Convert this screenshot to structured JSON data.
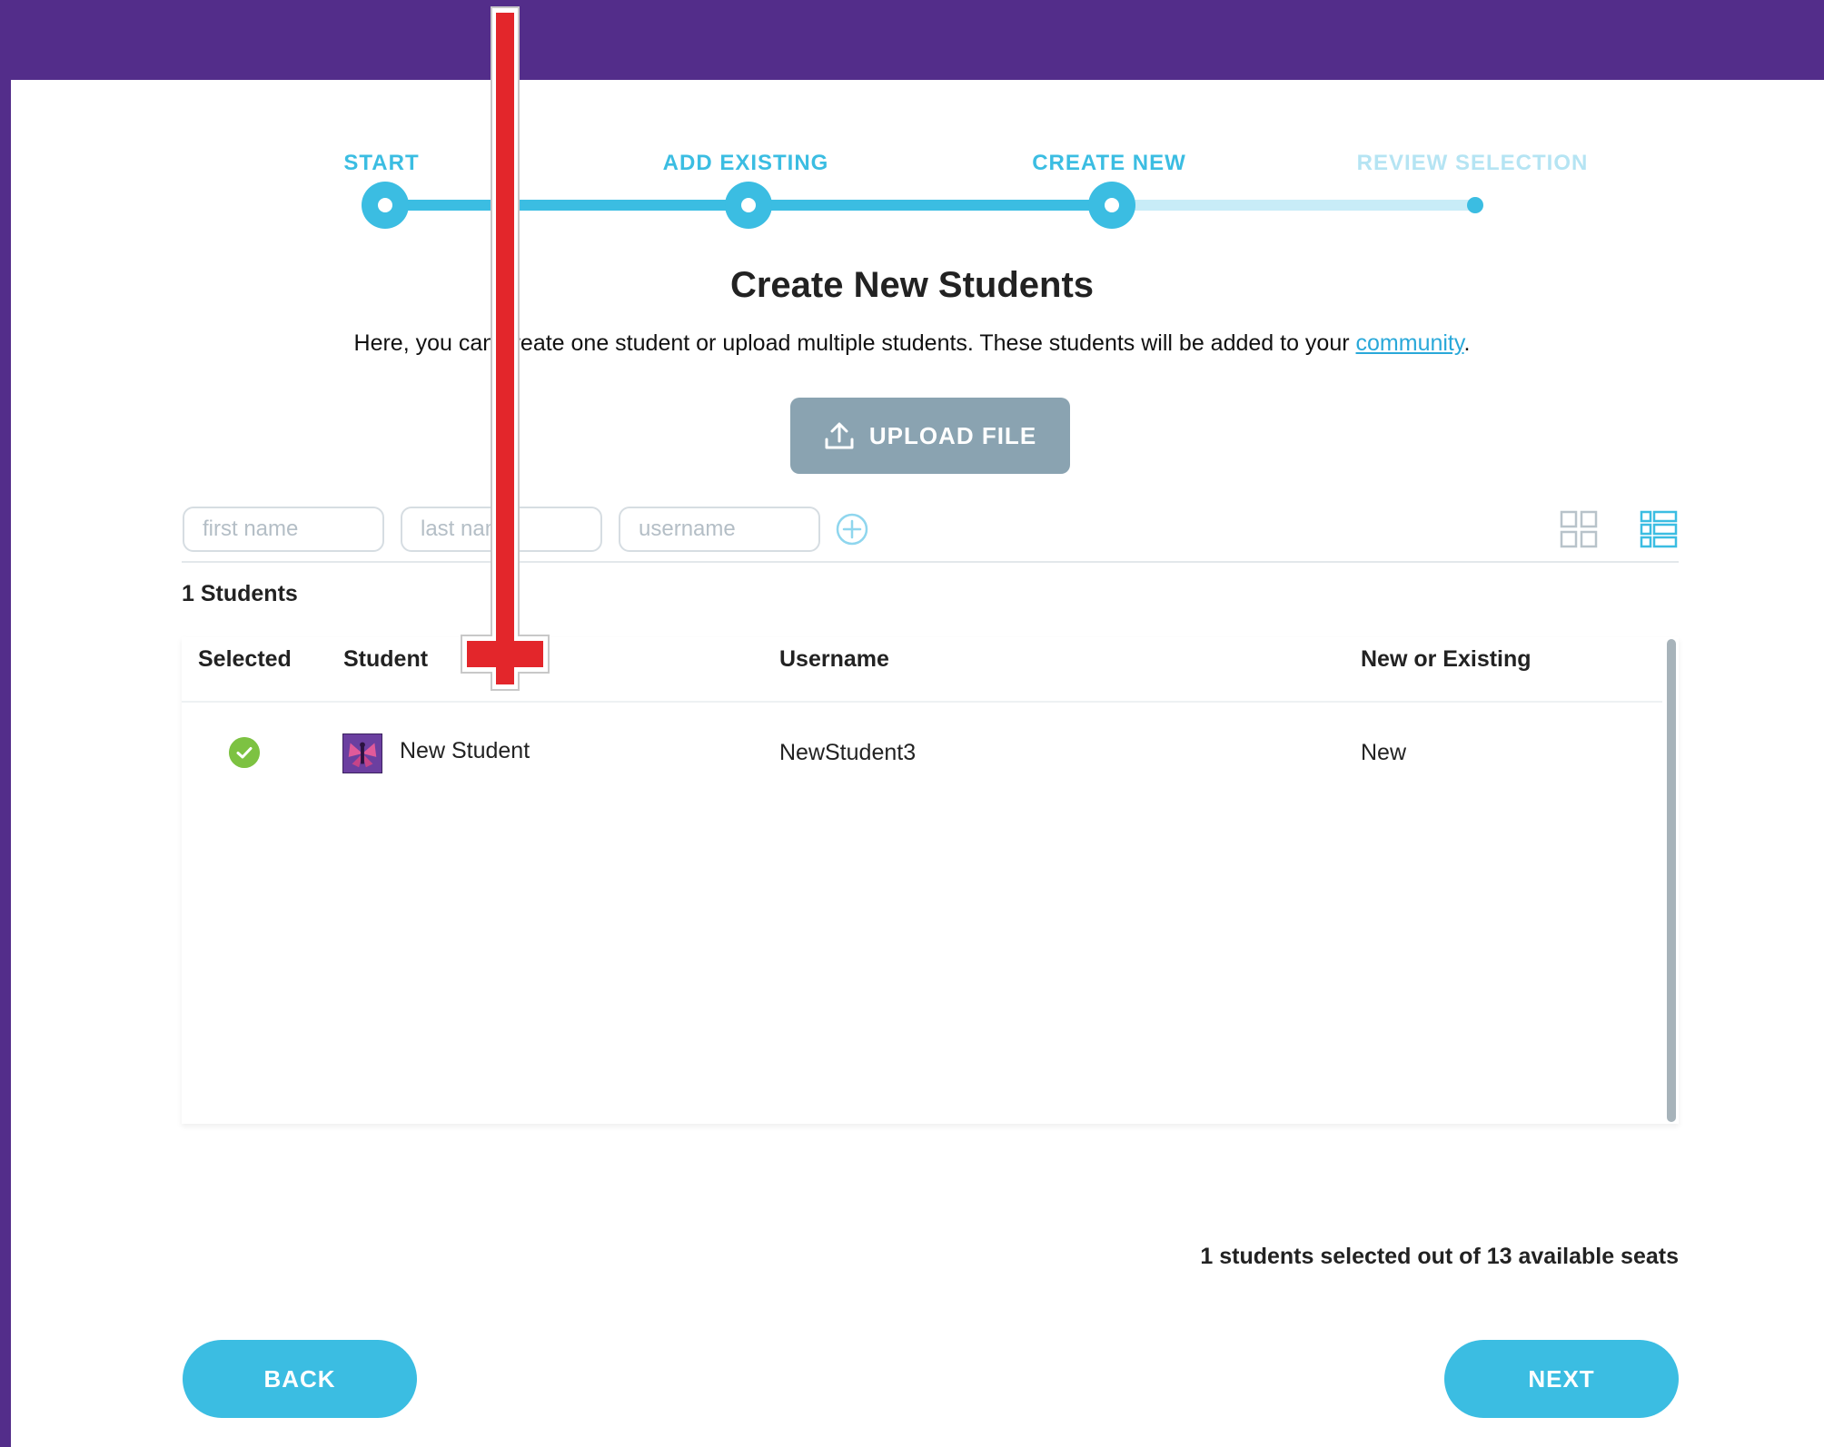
{
  "stepper": {
    "steps": [
      {
        "label": "START",
        "state": "done"
      },
      {
        "label": "ADD EXISTING",
        "state": "done"
      },
      {
        "label": "CREATE NEW",
        "state": "current"
      },
      {
        "label": "REVIEW SELECTION",
        "state": "pending"
      }
    ]
  },
  "header": {
    "title": "Create New Students",
    "description_before": "Here, you can create one student or upload multiple students. These students will be added to your ",
    "description_link": "community",
    "description_after": "."
  },
  "upload": {
    "label": "UPLOAD FILE"
  },
  "form": {
    "first_name_placeholder": "first name",
    "last_name_placeholder": "last name",
    "username_placeholder": "username"
  },
  "students": {
    "count_label": "1 Students",
    "columns": [
      "Selected",
      "Student",
      "Username",
      "New or Existing"
    ],
    "rows": [
      {
        "selected": true,
        "student": "New Student",
        "username": "NewStudent3",
        "status": "New"
      }
    ]
  },
  "footer": {
    "seats_text": "1 students selected out of 13 available seats",
    "back_label": "BACK",
    "next_label": "NEXT"
  },
  "colors": {
    "accent": "#3bbde2",
    "brand_purple": "#532d8a",
    "upload_button": "#8aa3b1",
    "selected_check": "#7dc242",
    "annotation_arrow": "#e3262b"
  }
}
